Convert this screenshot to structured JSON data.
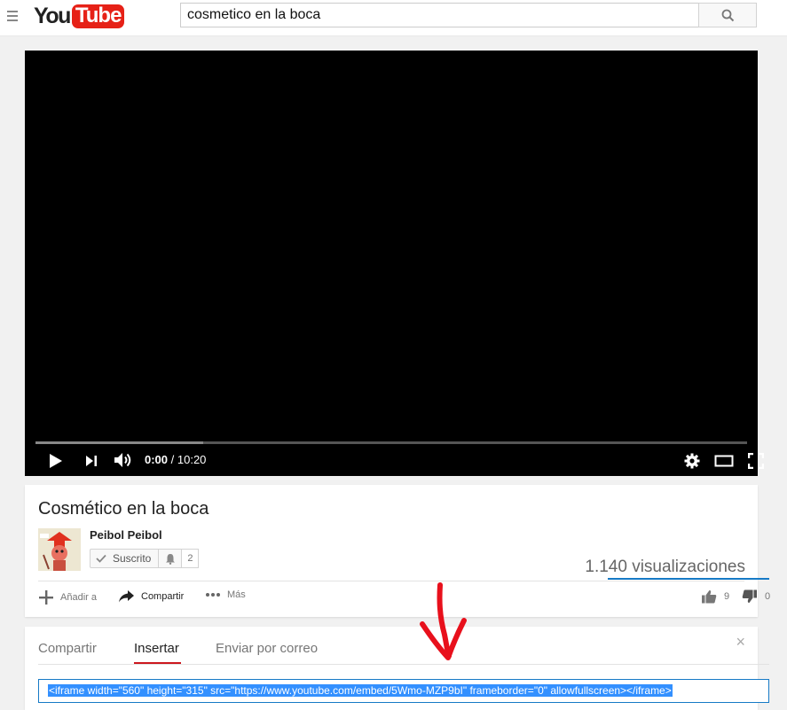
{
  "masthead": {
    "logo_you": "You",
    "logo_tube": "Tube",
    "search_value": "cosmetico en la boca"
  },
  "player": {
    "current_time": "0:00",
    "separator": " / ",
    "duration": "10:20",
    "loaded_fraction": 0.236
  },
  "video": {
    "title": "Cosmético en la boca",
    "channel": "Peibol Peibol",
    "subscribe_label": "Suscrito",
    "subscriber_count": "2",
    "views": "1.140 visualizaciones",
    "likes": "9",
    "dislikes": "0"
  },
  "actions": {
    "add_label": "Añadir a",
    "share_label": "Compartir",
    "more_label": "Más"
  },
  "share_panel": {
    "tabs": [
      "Compartir",
      "Insertar",
      "Enviar por correo"
    ],
    "active_tab": "Insertar",
    "close": "×",
    "embed_code": "<iframe width=\"560\" height=\"315\" src=\"https://www.youtube.com/embed/5Wmo-MZP9bI\" frameborder=\"0\" allowfullscreen></iframe>"
  },
  "colors": {
    "brand_red": "#e62117",
    "link_blue": "#167ac6",
    "selection": "#3390ff",
    "annotation_red": "#e8101c"
  },
  "icons": [
    "menu-icon",
    "search-icon",
    "play-icon",
    "next-icon",
    "volume-icon",
    "settings-icon",
    "theater-icon",
    "fullscreen-icon",
    "check-icon",
    "bell-icon",
    "plus-icon",
    "share-arrow-icon",
    "more-dots-icon",
    "thumbs-up-icon",
    "thumbs-down-icon",
    "close-icon"
  ]
}
